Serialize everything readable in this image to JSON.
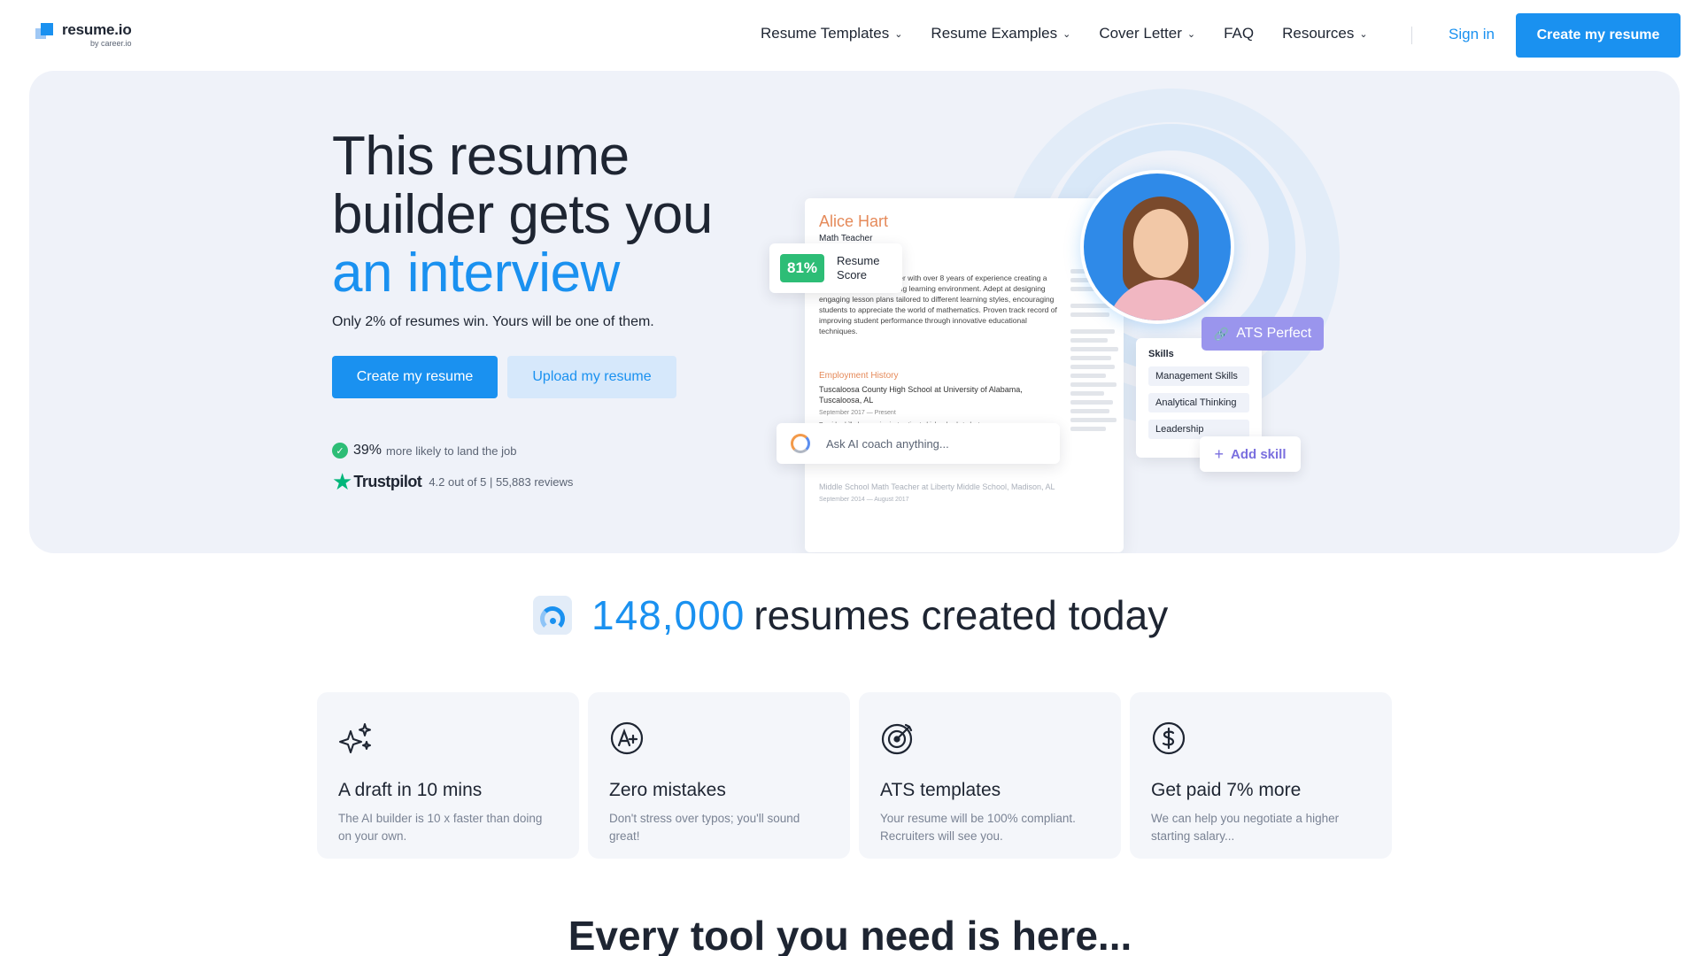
{
  "brand": {
    "name": "resume.io",
    "sub": "by career.io"
  },
  "nav": {
    "items": [
      {
        "label": "Resume Templates",
        "dropdown": true
      },
      {
        "label": "Resume Examples",
        "dropdown": true
      },
      {
        "label": "Cover Letter",
        "dropdown": true
      },
      {
        "label": "FAQ",
        "dropdown": false
      },
      {
        "label": "Resources",
        "dropdown": true
      }
    ],
    "signin": "Sign in",
    "cta": "Create my resume"
  },
  "hero": {
    "title_line1": "This resume",
    "title_line2": "builder gets you",
    "title_accent": "an interview",
    "subtitle": "Only 2% of resumes win. Yours will be one of them.",
    "primary_button": "Create my resume",
    "secondary_button": "Upload my resume",
    "stat_value": "39%",
    "stat_text": "more likely to land the job",
    "trustpilot_name": "Trustpilot",
    "trustpilot_text": "4.2 out of 5 | 55,883 reviews"
  },
  "illustration": {
    "resume_name": "Alice Hart",
    "resume_role": "Math Teacher",
    "resume_summary": "Enthusiastic math teacher with over 8 years of experience creating a nurturing and encouraging learning environment. Adept at designing engaging lesson plans tailored to different learning styles, encouraging students to appreciate the world of mathematics. Proven track record of improving student performance through innovative educational techniques.",
    "employment_heading": "Employment History",
    "employment_job": "Tuscaloosa County High School at University of Alabama, Tuscaloosa, AL",
    "employment_dates": "September 2017 — Present",
    "employment_bullet1": "Provide skilled, engaging instruction to high school students.",
    "employment_job2": "Middle School Math Teacher at Liberty Middle School, Madison, AL",
    "employment_dates2": "September 2014 — August 2017",
    "score_value": "81%",
    "score_label_1": "Resume",
    "score_label_2": "Score",
    "ats_label": "ATS Perfect",
    "skills_title": "Skills",
    "skills": [
      "Management Skills",
      "Analytical Thinking",
      "Leadership"
    ],
    "add_skill": "Add skill",
    "ai_prompt": "Ask AI coach anything..."
  },
  "counter": {
    "number": "148,000",
    "text": "resumes created today"
  },
  "features": [
    {
      "icon": "sparkles-icon",
      "title": "A draft in 10 mins",
      "desc": "The AI builder is 10 x faster than doing on your own."
    },
    {
      "icon": "a-plus-icon",
      "title": "Zero mistakes",
      "desc": "Don't stress over typos; you'll sound great!"
    },
    {
      "icon": "target-icon",
      "title": "ATS templates",
      "desc": "Your resume will be 100% compliant. Recruiters will see you."
    },
    {
      "icon": "dollar-icon",
      "title": "Get paid 7% more",
      "desc": "We can help you negotiate a higher starting salary..."
    }
  ],
  "bottom": {
    "title": "Every tool you need is here..."
  },
  "colors": {
    "accent": "#1a91f0",
    "hero_bg": "#eff2f9",
    "success": "#2dbd76",
    "ats": "#9a95ed"
  }
}
